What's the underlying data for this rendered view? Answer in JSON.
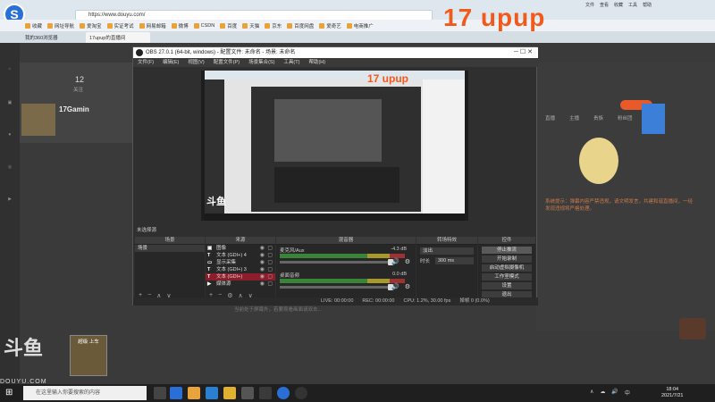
{
  "browser": {
    "url": "https://www.douyu.com/",
    "bookmarks": [
      "收藏",
      "网址导航",
      "爱淘宝",
      "实证考试",
      "网易邮箱",
      "微博",
      "CSDN",
      "百度",
      "天猫",
      "京东",
      "百度网盘",
      "爱奇艺",
      "电商推广"
    ],
    "tabs": [
      "我的360浏览器",
      "17upup的直播间"
    ],
    "right_menu": [
      "文件",
      "查看",
      "收藏",
      "工具",
      "帮助"
    ]
  },
  "watermark": "17 upup",
  "douyu": {
    "follow_count": "12",
    "follow_label": "关注",
    "streamer_name": "17Gamin",
    "right_tabs": [
      "直播",
      "主播",
      "贵族",
      "粉丝团"
    ],
    "chat_notice": "系统提示：弹幕内容严禁违规，请文明发言，共建和谐直播间，一经发现违规将严格处理。",
    "hint": "当前处于屏幕外，若要观看画面请双击...",
    "logo": "斗鱼",
    "site": "DOUYU.COM",
    "card_label": "超级 上车"
  },
  "obs": {
    "title": "OBS 27.0.1 (64-bit, windows) - 配置文件: 未命名 - 场景: 未命名",
    "menu": [
      "文件(F)",
      "编辑(E)",
      "视图(V)",
      "配置文件(P)",
      "场景集合(S)",
      "工具(T)",
      "帮助(H)"
    ],
    "scene_label": "未选择源",
    "docks": {
      "scenes": "场景",
      "sources": "来源",
      "mixer": "混音器",
      "transitions": "转场特效",
      "controls": "控件"
    },
    "scenes": [
      "场景"
    ],
    "sources": [
      {
        "name": "图像",
        "selected": false
      },
      {
        "name": "文本 (GDI+) 4",
        "selected": false
      },
      {
        "name": "显示采集",
        "selected": false
      },
      {
        "name": "文本 (GDI+) 3",
        "selected": false
      },
      {
        "name": "文本 (GDI+)",
        "selected": true
      },
      {
        "name": "媒体源",
        "selected": false
      }
    ],
    "mixer": [
      {
        "name": "麦克风/Aux",
        "db": "-4.3 dB"
      },
      {
        "name": "桌面音频",
        "db": "0.0 dB"
      }
    ],
    "transition": {
      "type": "淡出",
      "duration_label": "时长",
      "duration": "300 ms"
    },
    "controls": [
      "停止推流",
      "开始录制",
      "启动虚拟摄像机",
      "工作室模式",
      "设置",
      "退出"
    ],
    "status": {
      "live": "LIVE: 00:00:00",
      "rec": "REC: 00:00:00",
      "cpu": "CPU: 1.2%, 30.00 fps",
      "drop": "掉帧 0 (0.0%)"
    }
  },
  "taskbar": {
    "search_placeholder": "在这里输入你要搜索的内容",
    "time": "18:04",
    "date": "2021/7/21"
  }
}
